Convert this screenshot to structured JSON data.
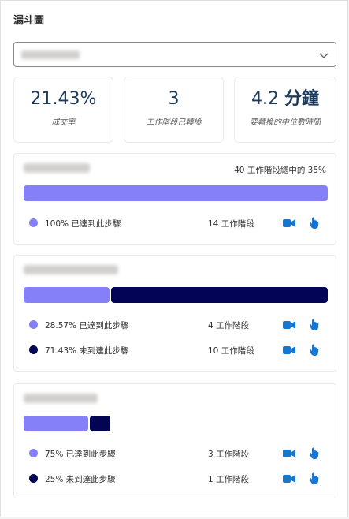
{
  "title": "漏斗圖",
  "dropdown": {
    "value": "",
    "chevron_icon": "chevron-down-icon"
  },
  "stats": [
    {
      "value": "21.43%",
      "unit": "",
      "label": "成交率"
    },
    {
      "value": "3",
      "unit": "",
      "label": "工作階段已轉換"
    },
    {
      "value": "4.2",
      "unit": "分鐘",
      "label": "要轉換的中位數時間"
    }
  ],
  "steps": [
    {
      "total": "40 工作階段總中的 35%",
      "reached_fraction": 1.0,
      "bar_fraction": 1.0,
      "rows": [
        {
          "kind": "reached",
          "text": "100% 已達到此步驟",
          "count": "14 工作階段"
        }
      ]
    },
    {
      "reached_fraction": 0.2857,
      "bar_fraction": 1.0,
      "rows": [
        {
          "kind": "reached",
          "text": "28.57% 已達到此步驟",
          "count": "4 工作階段"
        },
        {
          "kind": "dropped",
          "text": "71.43% 未到達此步驟",
          "count": "10 工作階段"
        }
      ]
    },
    {
      "reached_fraction": 0.75,
      "bar_fraction": 0.2857,
      "rows": [
        {
          "kind": "reached",
          "text": "75% 已達到此步驟",
          "count": "3 工作階段"
        },
        {
          "kind": "dropped",
          "text": "25% 未到達此步驟",
          "count": "1 工作階段"
        }
      ]
    }
  ],
  "row_icons": [
    "video-camera-icon",
    "hand-click-icon"
  ],
  "colors": {
    "reached": "#8680f8",
    "dropped": "#030453",
    "icon": "#1676d2",
    "accent": "#1b3a5c"
  }
}
